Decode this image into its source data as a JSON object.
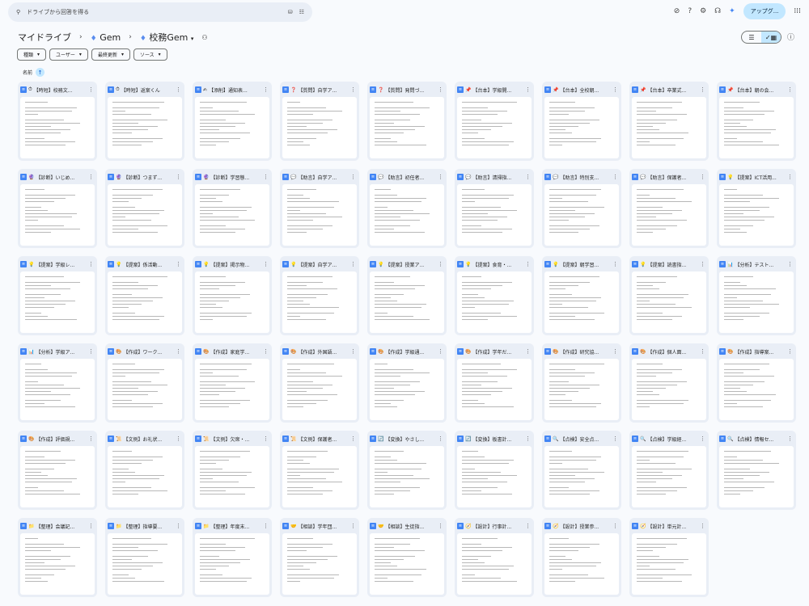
{
  "search": {
    "placeholder": "ドライブから回答を得る"
  },
  "topbar": {
    "upgrade_label": "アップグ..."
  },
  "breadcrumb": {
    "root": "マイドライブ",
    "folder1": "Gem",
    "folder2": "校務Gem"
  },
  "filters": [
    "種類",
    "ユーザー",
    "最終更新",
    "ソース"
  ],
  "sort": {
    "label": "名前"
  },
  "files": [
    {
      "emoji": "⏱",
      "title": "【時短】校務文..."
    },
    {
      "emoji": "⏱",
      "title": "【時短】返案くん"
    },
    {
      "emoji": "✍",
      "title": "【添削】通知表..."
    },
    {
      "emoji": "❓",
      "title": "【質問】自学ア..."
    },
    {
      "emoji": "❓",
      "title": "【質問】発問づ..."
    },
    {
      "emoji": "📌",
      "title": "【台本】学級開..."
    },
    {
      "emoji": "📌",
      "title": "【台本】全校朝..."
    },
    {
      "emoji": "📌",
      "title": "【台本】卒業式..."
    },
    {
      "emoji": "📌",
      "title": "【台本】朝の会..."
    },
    {
      "emoji": "🔮",
      "title": "【診断】いじめ..."
    },
    {
      "emoji": "🔮",
      "title": "【診断】つまず..."
    },
    {
      "emoji": "🔮",
      "title": "【診断】学習態..."
    },
    {
      "emoji": "💬",
      "title": "【助言】自学ア..."
    },
    {
      "emoji": "💬",
      "title": "【助言】初任者..."
    },
    {
      "emoji": "💬",
      "title": "【助言】清掃指..."
    },
    {
      "emoji": "💬",
      "title": "【助言】特別支..."
    },
    {
      "emoji": "💬",
      "title": "【助言】保護者..."
    },
    {
      "emoji": "💡",
      "title": "【提案】ICT活用..."
    },
    {
      "emoji": "💡",
      "title": "【提案】学級レ..."
    },
    {
      "emoji": "💡",
      "title": "【提案】係活動..."
    },
    {
      "emoji": "💡",
      "title": "【提案】掲示物..."
    },
    {
      "emoji": "💡",
      "title": "【提案】自学ア..."
    },
    {
      "emoji": "💡",
      "title": "【提案】授業ア..."
    },
    {
      "emoji": "💡",
      "title": "【提案】食育・..."
    },
    {
      "emoji": "💡",
      "title": "【提案】朝学習..."
    },
    {
      "emoji": "💡",
      "title": "【提案】読書指..."
    },
    {
      "emoji": "📊",
      "title": "【分析】テスト..."
    },
    {
      "emoji": "📊",
      "title": "【分析】学級ア..."
    },
    {
      "emoji": "🎨",
      "title": "【作成】ワーク..."
    },
    {
      "emoji": "🎨",
      "title": "【作成】家庭学..."
    },
    {
      "emoji": "🎨",
      "title": "【作成】外国語..."
    },
    {
      "emoji": "🎨",
      "title": "【作成】学級通..."
    },
    {
      "emoji": "🎨",
      "title": "【作成】学年だ..."
    },
    {
      "emoji": "🎨",
      "title": "【作成】研究協..."
    },
    {
      "emoji": "🎨",
      "title": "【作成】個人面..."
    },
    {
      "emoji": "🎨",
      "title": "【作成】指導案..."
    },
    {
      "emoji": "🎨",
      "title": "【作成】評価規..."
    },
    {
      "emoji": "📜",
      "title": "【文例】お礼状..."
    },
    {
      "emoji": "📜",
      "title": "【文例】欠席・..."
    },
    {
      "emoji": "📜",
      "title": "【文例】保護者..."
    },
    {
      "emoji": "🔄",
      "title": "【変換】やさし..."
    },
    {
      "emoji": "🔄",
      "title": "【変換】板書計..."
    },
    {
      "emoji": "🔍",
      "title": "【点検】安全点..."
    },
    {
      "emoji": "🔍",
      "title": "【点検】学級経..."
    },
    {
      "emoji": "🔍",
      "title": "【点検】情報セ..."
    },
    {
      "emoji": "📁",
      "title": "【整理】会議記..."
    },
    {
      "emoji": "📁",
      "title": "【整理】指導要..."
    },
    {
      "emoji": "📁",
      "title": "【整理】年度末..."
    },
    {
      "emoji": "🤝",
      "title": "【相談】学年団..."
    },
    {
      "emoji": "🤝",
      "title": "【相談】生徒指..."
    },
    {
      "emoji": "🧭",
      "title": "【設計】行事計..."
    },
    {
      "emoji": "🧭",
      "title": "【設計】授業参..."
    },
    {
      "emoji": "🧭",
      "title": "【設計】単元計..."
    }
  ]
}
